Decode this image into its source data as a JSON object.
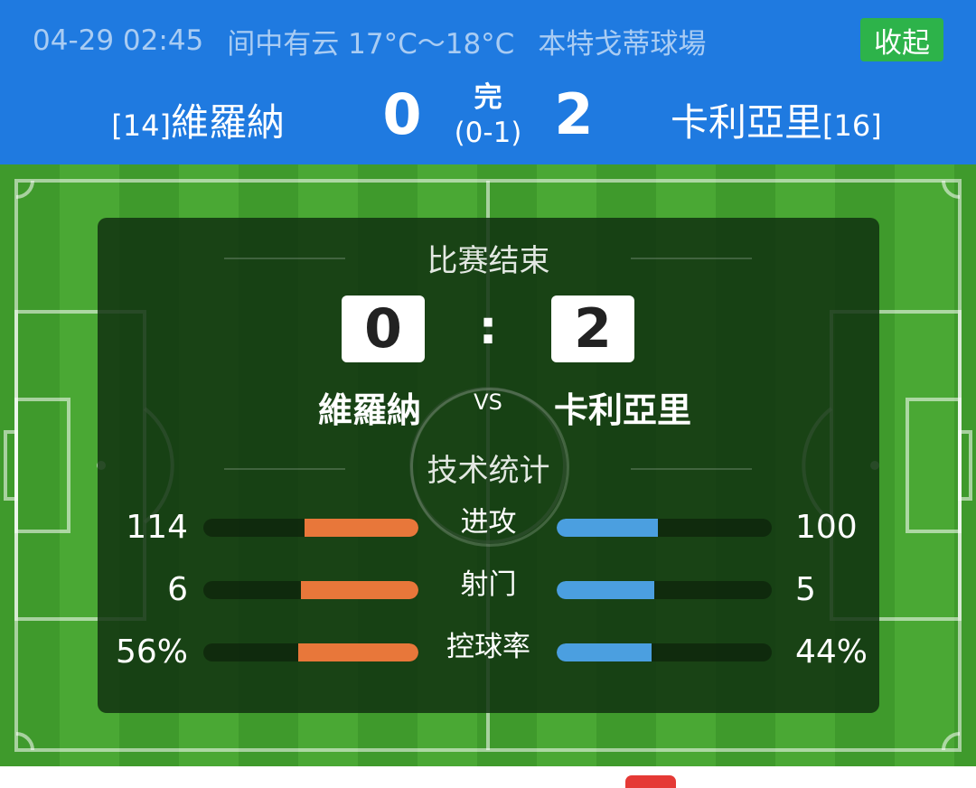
{
  "header": {
    "info": {
      "datetime": "04-29 02:45",
      "weather": "间中有云 17°C～18°C",
      "venue": "本特戈蒂球場"
    },
    "collapse_label": "收起",
    "home": {
      "rank": "[14]",
      "name": "維羅納",
      "score": "0"
    },
    "away": {
      "name": "卡利亞里",
      "rank": "[16]",
      "score": "2"
    },
    "status": "完",
    "half_time": "(0-1)"
  },
  "card": {
    "title": "比赛结束",
    "home_score": "0",
    "separator": ":",
    "away_score": "2",
    "home_name": "維羅納",
    "vs": "VS",
    "away_name": "卡利亞里",
    "stats_title": "技术统计",
    "stats": [
      {
        "label": "进攻",
        "home": "114",
        "away": "100",
        "home_share": 0.53,
        "away_share": 0.47
      },
      {
        "label": "射门",
        "home": "6",
        "away": "5",
        "home_share": 0.545,
        "away_share": 0.455
      },
      {
        "label": "控球率",
        "home": "56%",
        "away": "44%",
        "home_share": 0.56,
        "away_share": 0.44
      }
    ]
  },
  "colors": {
    "header_bg": "#1f7ae0",
    "collapse_bg": "#2db34a",
    "home_bar": "#e8773a",
    "away_bar": "#4b9fe0"
  }
}
